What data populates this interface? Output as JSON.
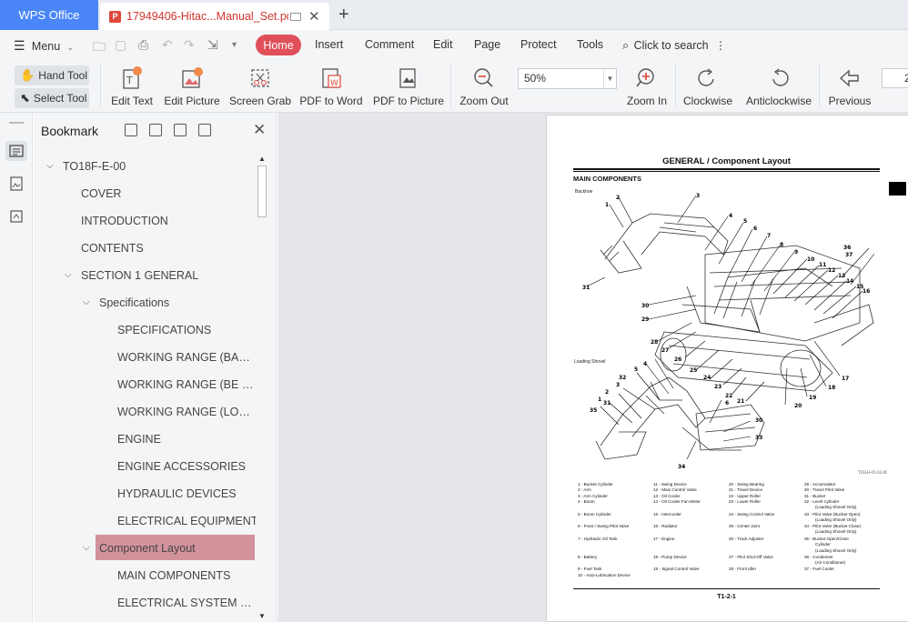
{
  "titlebar": {
    "app_tab": "WPS Office",
    "doc_tab": "17949406-Hitac...Manual_Set.pdf",
    "new_tab": "+"
  },
  "menubar": {
    "menu_label": "Menu",
    "tabs": [
      "Home",
      "Insert",
      "Comment",
      "Edit",
      "Page",
      "Protect",
      "Tools"
    ],
    "search_label": "Click to search"
  },
  "toolbar": {
    "hand_tool": "Hand Tool",
    "select_tool": "Select Tool",
    "buttons": [
      "Edit Text",
      "Edit Picture",
      "Screen Grab",
      "PDF to Word",
      "PDF to Picture",
      "Zoom Out",
      "Zoom In",
      "Clockwise",
      "Anticlockwise",
      "Previous"
    ],
    "zoom_value": "50%",
    "page_number": "2"
  },
  "bookmark_panel": {
    "title": "Bookmark",
    "items": [
      {
        "label": "TO18F-E-00"
      },
      {
        "label": "COVER"
      },
      {
        "label": "INTRODUCTION"
      },
      {
        "label": "CONTENTS"
      },
      {
        "label": "SECTION 1 GENERAL"
      },
      {
        "label": "Specifications"
      },
      {
        "label": "SPECIFICATIONS"
      },
      {
        "label": "WORKING RANGE (BACKH.."
      },
      {
        "label": "WORKING RANGE (BE BAC.."
      },
      {
        "label": "WORKING RANGE (LOADI..."
      },
      {
        "label": "ENGINE"
      },
      {
        "label": "ENGINE ACCESSORIES"
      },
      {
        "label": "HYDRAULIC DEVICES"
      },
      {
        "label": "ELECTRICAL EQUIPMENT"
      },
      {
        "label": "Component Layout"
      },
      {
        "label": "MAIN COMPONENTS"
      },
      {
        "label": "ELECTRICAL SYSTEM COM.."
      }
    ]
  },
  "document": {
    "header": "GENERAL / Component Layout",
    "subheader": "MAIN COMPONENTS",
    "caption_backhoe": "Backhoe",
    "caption_loading": "Loading Shovel",
    "legend": [
      "1 -  Bucket Cylinder",
      "2 -  Arm",
      "3 -  Arm Cylinder",
      "4 -  Boom",
      "5 -  Boom Cylinder",
      "6 -  Front / Swing Pilot Valve",
      "7 -  Hydraulic Oil Tank",
      "8 -  Battery",
      "9 -  Fuel Tank",
      "10 - Auto-Lubrication Device",
      "11 - Swing Device",
      "12 - Main Control Valve",
      "13 - Oil Cooler",
      "14 - Oil Cooler Fan Motor",
      "15 - Intercooler",
      "16 - Radiator",
      "17 - Engine",
      "18 - Pump Device",
      "19 - Signal Control Valve",
      "20 - Swing Bearing",
      "21 - Travel Device",
      "22 - Upper Roller",
      "23 - Lower Roller",
      "24 - Swing Control Valve",
      "25 - Center Joint",
      "26 - Track Adjuster",
      "27 - Pilot Shut-Off Valve",
      "28 - Front Idler",
      "29 - Accumulator",
      "30 - Travel Pilot Valve",
      "31 - Bucket",
      "32 - Level Cylinder",
      "(Loading Shovel Only)",
      "33 - Pilot Valve (Bucket Open)",
      "(Loading Shovel Only)",
      "34 - Pilot Valve (Bucket Close)",
      "(Loading Shovel Only)",
      "35 - Bucket Open/Close",
      "Cylinder",
      "(Loading Shovel Only)",
      "36 - Condenser",
      "(Air Conditioner)",
      "37 - Fuel Cooler"
    ],
    "footer": "T1-2-1"
  }
}
